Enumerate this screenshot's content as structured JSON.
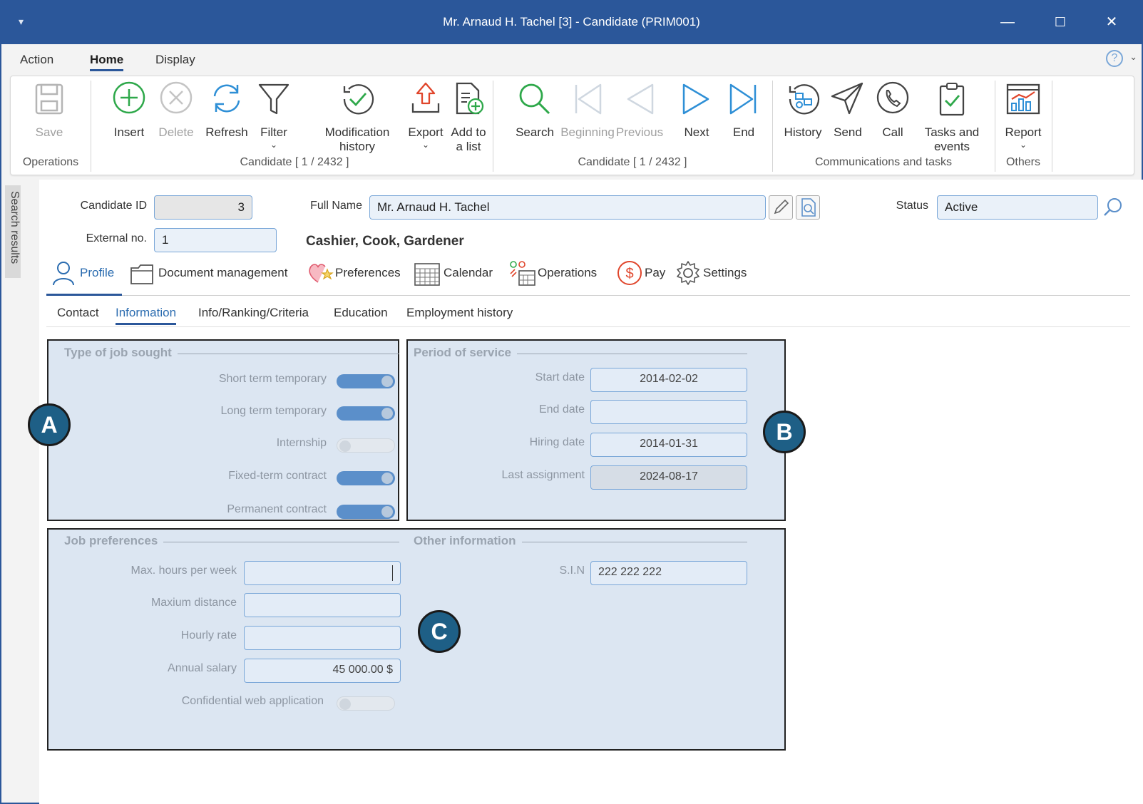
{
  "window": {
    "title": "Mr. Arnaud H. Tachel [3] - Candidate (PRIM001)",
    "minimize": "—",
    "maximize": "☐",
    "close": "✕"
  },
  "menu": {
    "tabs": [
      "Action",
      "Home",
      "Display"
    ],
    "active": "Home",
    "help": "?"
  },
  "ribbon": {
    "groups": {
      "operations": "Operations",
      "candidate_records": "Candidate [ 1 / 2432 ]",
      "candidate_nav": "Candidate [ 1 / 2432 ]",
      "communications": "Communications and tasks",
      "others": "Others"
    },
    "buttons": {
      "save": "Save",
      "insert": "Insert",
      "delete": "Delete",
      "refresh": "Refresh",
      "filter": "Filter",
      "modification_history_1": "Modification",
      "modification_history_2": "history",
      "export": "Export",
      "add_to_list_1": "Add to",
      "add_to_list_2": "a list",
      "search": "Search",
      "beginning": "Beginning",
      "previous": "Previous",
      "next": "Next",
      "end": "End",
      "history": "History",
      "send": "Send",
      "call": "Call",
      "tasks_1": "Tasks and",
      "tasks_2": "events",
      "report": "Report"
    }
  },
  "sidebar": {
    "label": "Search results"
  },
  "header": {
    "candidate_id_label": "Candidate ID",
    "candidate_id": "3",
    "external_no_label": "External no.",
    "external_no": "1",
    "full_name_label": "Full Name",
    "full_name": "Mr. Arnaud H. Tachel",
    "occupations": "Cashier, Cook, Gardener",
    "status_label": "Status",
    "status": "Active"
  },
  "profile_tabs": [
    "Profile",
    "Document management",
    "Preferences",
    "Calendar",
    "Operations",
    "Pay",
    "Settings"
  ],
  "sub_tabs": [
    "Contact",
    "Information",
    "Info/Ranking/Criteria",
    "Education",
    "Employment history"
  ],
  "job_sought": {
    "title": "Type of job sought",
    "items": [
      {
        "label": "Short term temporary",
        "on": true
      },
      {
        "label": "Long term temporary",
        "on": true
      },
      {
        "label": "Internship",
        "on": false
      },
      {
        "label": "Fixed-term contract",
        "on": true
      },
      {
        "label": "Permanent contract",
        "on": true
      }
    ]
  },
  "period_of_service": {
    "title": "Period of service",
    "start_date_label": "Start date",
    "start_date": "2014-02-02",
    "end_date_label": "End date",
    "end_date": "",
    "hiring_date_label": "Hiring date",
    "hiring_date": "2014-01-31",
    "last_assignment_label": "Last assignment",
    "last_assignment": "2024-08-17"
  },
  "job_preferences": {
    "title": "Job preferences",
    "max_hours_label": "Max. hours per week",
    "max_hours": "",
    "max_distance_label": "Maxium distance",
    "max_distance": "",
    "hourly_rate_label": "Hourly rate",
    "hourly_rate": "",
    "annual_salary_label": "Annual salary",
    "annual_salary": "45 000.00 $",
    "confidential_label": "Confidential web application",
    "confidential_on": false
  },
  "other_information": {
    "title": "Other information",
    "sin_label": "S.I.N",
    "sin": "222 222 222"
  },
  "callouts": {
    "a": "A",
    "b": "B",
    "c": "C"
  },
  "colors": {
    "accent": "#2b579a",
    "panel": "#dce6f2",
    "toggle_on": "#5b8fca",
    "callout": "#1e5f86"
  }
}
